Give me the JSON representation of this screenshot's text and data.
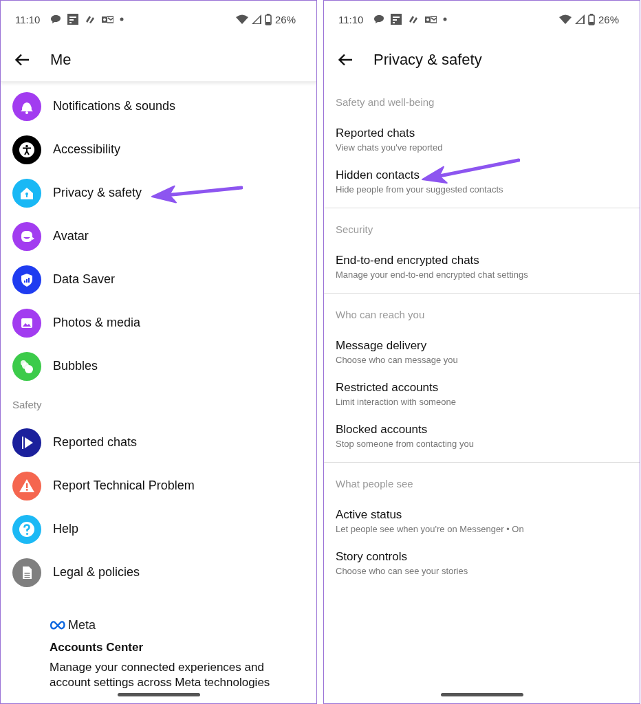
{
  "left": {
    "status_bar": {
      "time": "11:10",
      "battery": "26%"
    },
    "header": {
      "title": "Me"
    },
    "items": [
      {
        "kind": "row",
        "label": "Notifications & sounds",
        "color": "#a23cf0",
        "pointed": false
      },
      {
        "kind": "row",
        "label": "Accessibility",
        "color": "#000000",
        "pointed": false
      },
      {
        "kind": "row",
        "label": "Privacy & safety",
        "color": "#19b8f5",
        "pointed": true
      },
      {
        "kind": "row",
        "label": "Avatar",
        "color": "#a23cf0",
        "pointed": false
      },
      {
        "kind": "row",
        "label": "Data Saver",
        "color": "#1f3cf0",
        "pointed": false
      },
      {
        "kind": "row",
        "label": "Photos & media",
        "color": "#a23cf0",
        "pointed": false
      },
      {
        "kind": "row",
        "label": "Bubbles",
        "color": "#3ccb4a",
        "pointed": false
      },
      {
        "kind": "section",
        "label": "Safety"
      },
      {
        "kind": "row",
        "label": "Reported chats",
        "color": "#1b209c",
        "pointed": false
      },
      {
        "kind": "row",
        "label": "Report Technical Problem",
        "color": "#f5664f",
        "pointed": false
      },
      {
        "kind": "row",
        "label": "Help",
        "color": "#1cb9f5",
        "pointed": false
      },
      {
        "kind": "row",
        "label": "Legal & policies",
        "color": "#7f7f7f",
        "pointed": false
      }
    ],
    "accounts_center": {
      "brand": "Meta",
      "title": "Accounts Center",
      "description": "Manage your connected experiences and account settings across Meta technologies"
    }
  },
  "right": {
    "status_bar": {
      "time": "11:10",
      "battery": "26%"
    },
    "header": {
      "title": "Privacy & safety"
    },
    "sections": [
      {
        "heading": "Safety and well-being",
        "rows": [
          {
            "title": "Reported chats",
            "subtitle": "View chats you've reported",
            "pointed": false
          },
          {
            "title": "Hidden contacts",
            "subtitle": "Hide people from your suggested contacts",
            "pointed": true
          }
        ]
      },
      {
        "heading": "Security",
        "rows": [
          {
            "title": "End-to-end encrypted chats",
            "subtitle": "Manage your end-to-end encrypted chat settings",
            "pointed": false
          }
        ]
      },
      {
        "heading": "Who can reach you",
        "rows": [
          {
            "title": "Message delivery",
            "subtitle": "Choose who can message you",
            "pointed": false
          },
          {
            "title": "Restricted accounts",
            "subtitle": "Limit interaction with someone",
            "pointed": false
          },
          {
            "title": "Blocked accounts",
            "subtitle": "Stop someone from contacting you",
            "pointed": false
          }
        ]
      },
      {
        "heading": "What people see",
        "rows": [
          {
            "title": "Active status",
            "subtitle": "Let people see when you're on Messenger • On",
            "pointed": false
          },
          {
            "title": "Story controls",
            "subtitle": "Choose who can see your stories",
            "pointed": false
          }
        ]
      }
    ]
  }
}
